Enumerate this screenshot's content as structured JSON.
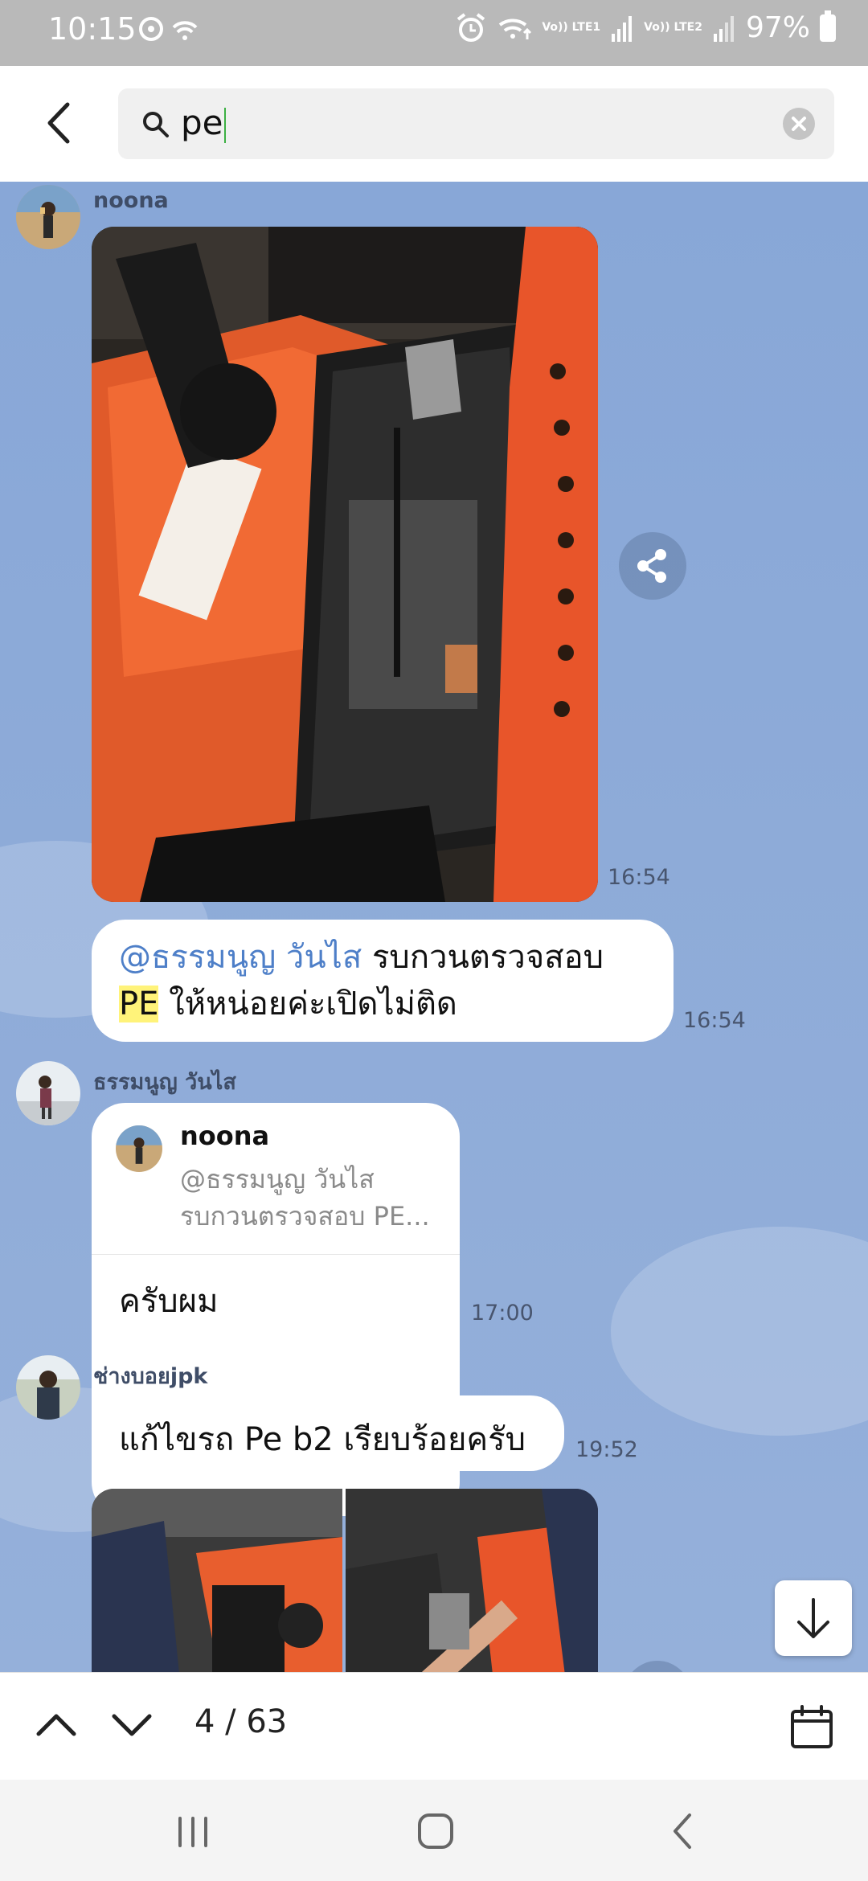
{
  "status_bar": {
    "time": "10:15",
    "battery": "97%",
    "sim1": "Vo)) LTE1",
    "sim2": "Vo)) LTE2"
  },
  "search": {
    "query": "pe"
  },
  "messages": [
    {
      "sender": "noona",
      "type": "image",
      "time": "16:54"
    },
    {
      "type": "text",
      "mention": "@ธรรมนูญ วันไส",
      "text_part1": " รบกวนตรวจสอบ",
      "highlight": "PE",
      "text_part2": " ให้หน่อยค่ะเปิดไม่ติด",
      "time": "16:54"
    },
    {
      "sender": "ธรรมนูญ วันไส",
      "type": "reply",
      "quote_sender": "noona",
      "quote_line1": "@ธรรมนูญ วันไส",
      "quote_line2": "รบกวนตรวจสอบ PE...",
      "text": "ครับผม",
      "time": "17:00"
    },
    {
      "sender": "ช่างบอยjpk",
      "type": "text",
      "text": "แก้ไขรถ Pe b2 เรียบร้อยครับ",
      "time": "19:52"
    },
    {
      "type": "image-album",
      "images": 2
    }
  ],
  "navigator": {
    "result_count": "4 / 63"
  },
  "colors": {
    "chat_background": "#8fa9d6",
    "mention": "#4e7fc8",
    "highlight": "#fff37a"
  },
  "icons": {
    "back": "chevron-left-icon",
    "search": "search-icon",
    "clear": "clear-icon",
    "share": "share-icon",
    "scroll_down": "arrow-down-icon",
    "prev": "chevron-up-icon",
    "next": "chevron-down-icon",
    "calendar": "calendar-icon"
  }
}
